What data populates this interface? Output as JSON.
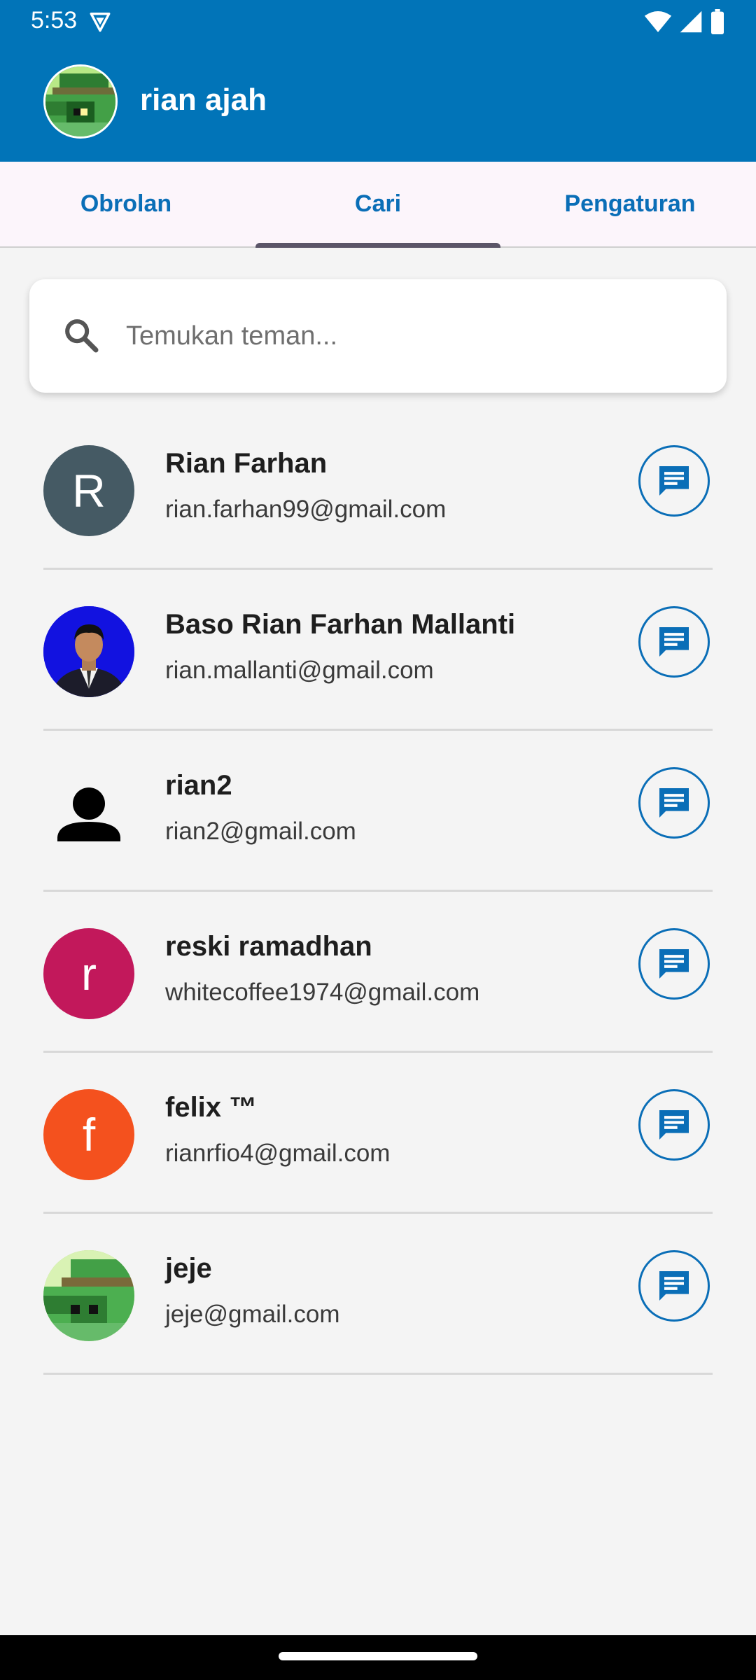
{
  "status_bar": {
    "time": "5:53",
    "icons": [
      "vpn-icon",
      "wifi-icon",
      "signal-icon",
      "battery-icon"
    ]
  },
  "app_bar": {
    "title": "rian ajah",
    "avatar_icon": "pixel-character-avatar",
    "background_color": "#0174b8"
  },
  "tabs": [
    {
      "label": "Obrolan",
      "selected": false
    },
    {
      "label": "Cari",
      "selected": true
    },
    {
      "label": "Pengaturan",
      "selected": false
    }
  ],
  "search": {
    "placeholder": "Temukan teman...",
    "value": "",
    "icon": "search-icon"
  },
  "users": [
    {
      "name": "Rian Farhan",
      "email": "rian.farhan99@gmail.com",
      "avatar_type": "letter",
      "avatar_letter": "R",
      "avatar_color": "#455a64"
    },
    {
      "name": "Baso Rian Farhan Mallanti",
      "email": "rian.mallanti@gmail.com",
      "avatar_type": "photo",
      "avatar_color": "#1212e0"
    },
    {
      "name": "rian2",
      "email": "rian2@gmail.com",
      "avatar_type": "silhouette",
      "avatar_color": "#000000"
    },
    {
      "name": "reski ramadhan",
      "email": "whitecoffee1974@gmail.com",
      "avatar_type": "letter",
      "avatar_letter": "r",
      "avatar_color": "#c2185b"
    },
    {
      "name": "felix ™",
      "email": "rianrfio4@gmail.com",
      "avatar_type": "letter",
      "avatar_letter": "f",
      "avatar_color": "#f4511e"
    },
    {
      "name": "jeje",
      "email": "jeje@gmail.com",
      "avatar_type": "pixel",
      "avatar_color": "#a5d36a"
    }
  ],
  "colors": {
    "accent": "#0a6eb7",
    "tab_indicator": "#5b5568",
    "background": "#f4f4f4"
  }
}
